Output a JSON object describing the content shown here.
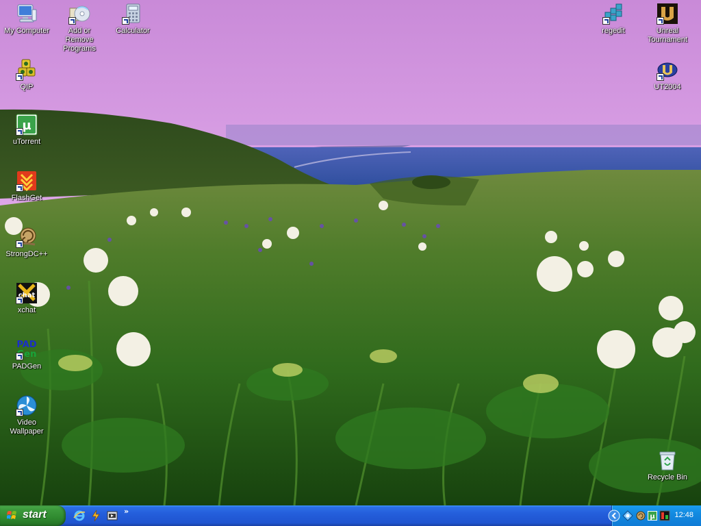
{
  "desktop": {
    "icons": {
      "my_computer": "My Computer",
      "add_remove": "Add or Remove Programs",
      "calculator": "Calculator",
      "regedit": "regedit",
      "unreal": "Unreal Tournament",
      "qip": "QIP",
      "ut2004": "UT2004",
      "utorrent": "uTorrent",
      "flashget": "FlashGet",
      "strongdc": "StrongDC++",
      "xchat": "xchat",
      "padgen": "PADGen",
      "video_wallpaper": "Video Wallpaper",
      "recycle_bin": "Recycle Bin"
    },
    "icon_glyphs": {
      "xchat": "chat",
      "padgen_top": "PAD",
      "padgen_bottom": "Gen"
    }
  },
  "taskbar": {
    "start_label": "start",
    "quick_launch_more": "»",
    "clock": "12:48"
  }
}
